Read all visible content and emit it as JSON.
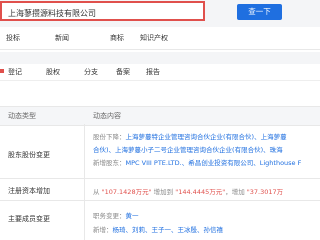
{
  "search": {
    "query": "上海蓼攒源料技有限公司",
    "button_label": "查一下"
  },
  "nav": {
    "items": [
      "投标",
      "新闻",
      "商标",
      "知识产权"
    ],
    "prefix_icon_char": "|"
  },
  "tabs": [
    "登记",
    "股权",
    "分支",
    "备案",
    "报告"
  ],
  "table": {
    "headers": [
      "动态类型",
      "动态内容"
    ],
    "rows": [
      {
        "type": "股东股份变更",
        "lines": [
          {
            "label": "股份下降：",
            "value": "上海萝蔓特企业管理咨询合伙企业(有限合伙)、上海萝蔓"
          },
          {
            "label": "",
            "value": "合伙)、上海萝蔓小子二号企业管理咨询合伙企业(有限合伙)、珠海"
          },
          {
            "label": "新增股东：",
            "value": "MPC VIII PTE.LTD.、希昌创业投资有限公司、Lighthouse F"
          }
        ]
      },
      {
        "type": "注册资本增加",
        "lines": [
          {
            "pre": "从 ",
            "v1": "\"107.1428万元\"",
            "mid": " 增加到 ",
            "v2": "\"144.4445万元\"",
            "mid2": "，增加 ",
            "v3": "\"37.3017万"
          }
        ]
      },
      {
        "type": "主要成员变更",
        "lines": [
          {
            "label": "职务变更：",
            "value": "黄一"
          },
          {
            "label": "新增：",
            "value": "杨琦、刘莉、王子一、王冰殷、孙信禧"
          }
        ]
      }
    ]
  }
}
